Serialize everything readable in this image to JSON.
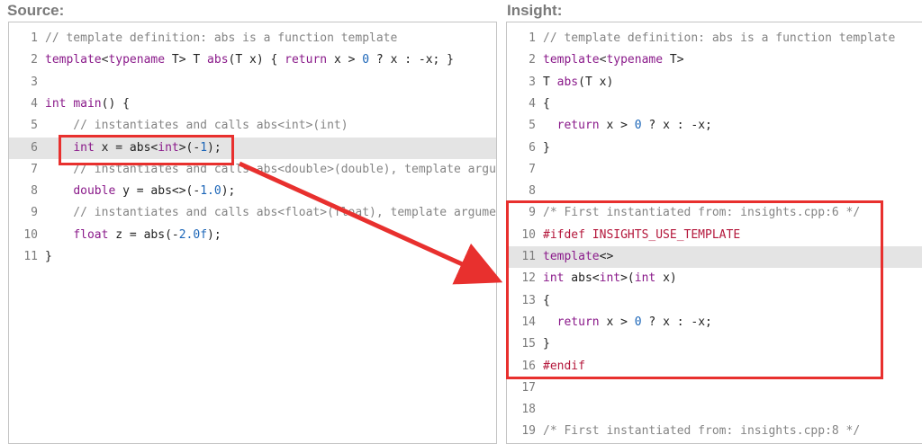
{
  "source": {
    "title": "Source:",
    "highlight_line": 6,
    "lines": [
      {
        "n": "1",
        "tokens": [
          {
            "t": "// template definition: abs is a function template",
            "c": "com"
          }
        ]
      },
      {
        "n": "2",
        "tokens": [
          {
            "t": "template",
            "c": "kw"
          },
          {
            "t": "<",
            "c": "op"
          },
          {
            "t": "typename",
            "c": "kw"
          },
          {
            "t": " T> T ",
            "c": ""
          },
          {
            "t": "abs",
            "c": "kw"
          },
          {
            "t": "(T x) { ",
            "c": ""
          },
          {
            "t": "return",
            "c": "kw"
          },
          {
            "t": " x > ",
            "c": ""
          },
          {
            "t": "0",
            "c": "num"
          },
          {
            "t": " ? x : -x; }",
            "c": ""
          }
        ]
      },
      {
        "n": "3",
        "tokens": []
      },
      {
        "n": "4",
        "tokens": [
          {
            "t": "int",
            "c": "kw"
          },
          {
            "t": " ",
            "c": ""
          },
          {
            "t": "main",
            "c": "kw"
          },
          {
            "t": "() {",
            "c": ""
          }
        ]
      },
      {
        "n": "5",
        "tokens": [
          {
            "t": "    // instantiates and calls abs<int>(int)",
            "c": "com"
          }
        ]
      },
      {
        "n": "6",
        "tokens": [
          {
            "t": "    ",
            "c": ""
          },
          {
            "t": "int",
            "c": "kw"
          },
          {
            "t": " x = abs<",
            "c": ""
          },
          {
            "t": "int",
            "c": "kw"
          },
          {
            "t": ">(-",
            "c": ""
          },
          {
            "t": "1",
            "c": "num"
          },
          {
            "t": ");",
            "c": ""
          }
        ]
      },
      {
        "n": "7",
        "tokens": [
          {
            "t": "    // instantiates and calls abs<double>(double), template argument",
            "c": "com"
          }
        ]
      },
      {
        "n": "8",
        "tokens": [
          {
            "t": "    ",
            "c": ""
          },
          {
            "t": "double",
            "c": "kw"
          },
          {
            "t": " y = abs<>(-",
            "c": ""
          },
          {
            "t": "1.0",
            "c": "num"
          },
          {
            "t": ");",
            "c": ""
          }
        ]
      },
      {
        "n": "9",
        "tokens": [
          {
            "t": "    // instantiates and calls abs<float>(float), template argument",
            "c": "com"
          }
        ]
      },
      {
        "n": "10",
        "tokens": [
          {
            "t": "    ",
            "c": ""
          },
          {
            "t": "float",
            "c": "kw"
          },
          {
            "t": " z = abs(-",
            "c": ""
          },
          {
            "t": "2.0f",
            "c": "num"
          },
          {
            "t": ");",
            "c": ""
          }
        ]
      },
      {
        "n": "11",
        "tokens": [
          {
            "t": "}",
            "c": ""
          }
        ]
      }
    ]
  },
  "insight": {
    "title": "Insight:",
    "highlight_line": 11,
    "lines": [
      {
        "n": "1",
        "tokens": [
          {
            "t": "// template definition: abs is a function template",
            "c": "com"
          }
        ]
      },
      {
        "n": "2",
        "tokens": [
          {
            "t": "template",
            "c": "kw"
          },
          {
            "t": "<",
            "c": "op"
          },
          {
            "t": "typename",
            "c": "kw"
          },
          {
            "t": " T>",
            "c": ""
          }
        ]
      },
      {
        "n": "3",
        "tokens": [
          {
            "t": "T ",
            "c": ""
          },
          {
            "t": "abs",
            "c": "kw"
          },
          {
            "t": "(T x)",
            "c": ""
          }
        ]
      },
      {
        "n": "4",
        "tokens": [
          {
            "t": "{",
            "c": ""
          }
        ]
      },
      {
        "n": "5",
        "tokens": [
          {
            "t": "  ",
            "c": ""
          },
          {
            "t": "return",
            "c": "kw"
          },
          {
            "t": " x > ",
            "c": ""
          },
          {
            "t": "0",
            "c": "num"
          },
          {
            "t": " ? x : -x;",
            "c": ""
          }
        ]
      },
      {
        "n": "6",
        "tokens": [
          {
            "t": "}",
            "c": ""
          }
        ]
      },
      {
        "n": "7",
        "tokens": []
      },
      {
        "n": "8",
        "tokens": []
      },
      {
        "n": "9",
        "tokens": [
          {
            "t": "/* First instantiated from: insights.cpp:6 */",
            "c": "com"
          }
        ]
      },
      {
        "n": "10",
        "tokens": [
          {
            "t": "#ifdef INSIGHTS_USE_TEMPLATE",
            "c": "pp"
          }
        ]
      },
      {
        "n": "11",
        "tokens": [
          {
            "t": "template",
            "c": "kw"
          },
          {
            "t": "<>",
            "c": ""
          }
        ]
      },
      {
        "n": "12",
        "tokens": [
          {
            "t": "int",
            "c": "kw"
          },
          {
            "t": " abs<",
            "c": ""
          },
          {
            "t": "int",
            "c": "kw"
          },
          {
            "t": ">(",
            "c": ""
          },
          {
            "t": "int",
            "c": "kw"
          },
          {
            "t": " x)",
            "c": ""
          }
        ]
      },
      {
        "n": "13",
        "tokens": [
          {
            "t": "{",
            "c": ""
          }
        ]
      },
      {
        "n": "14",
        "tokens": [
          {
            "t": "  ",
            "c": ""
          },
          {
            "t": "return",
            "c": "kw"
          },
          {
            "t": " x > ",
            "c": ""
          },
          {
            "t": "0",
            "c": "num"
          },
          {
            "t": " ? x : -x;",
            "c": ""
          }
        ]
      },
      {
        "n": "15",
        "tokens": [
          {
            "t": "}",
            "c": ""
          }
        ]
      },
      {
        "n": "16",
        "tokens": [
          {
            "t": "#endif",
            "c": "pp"
          }
        ]
      },
      {
        "n": "17",
        "tokens": []
      },
      {
        "n": "18",
        "tokens": []
      },
      {
        "n": "19",
        "tokens": [
          {
            "t": "/* First instantiated from: insights.cpp:8 */",
            "c": "com"
          }
        ]
      }
    ]
  },
  "annotation": {
    "color": "#e8302e",
    "source_box_line": 6,
    "insight_box_from_line": 9,
    "insight_box_to_line": 16
  }
}
